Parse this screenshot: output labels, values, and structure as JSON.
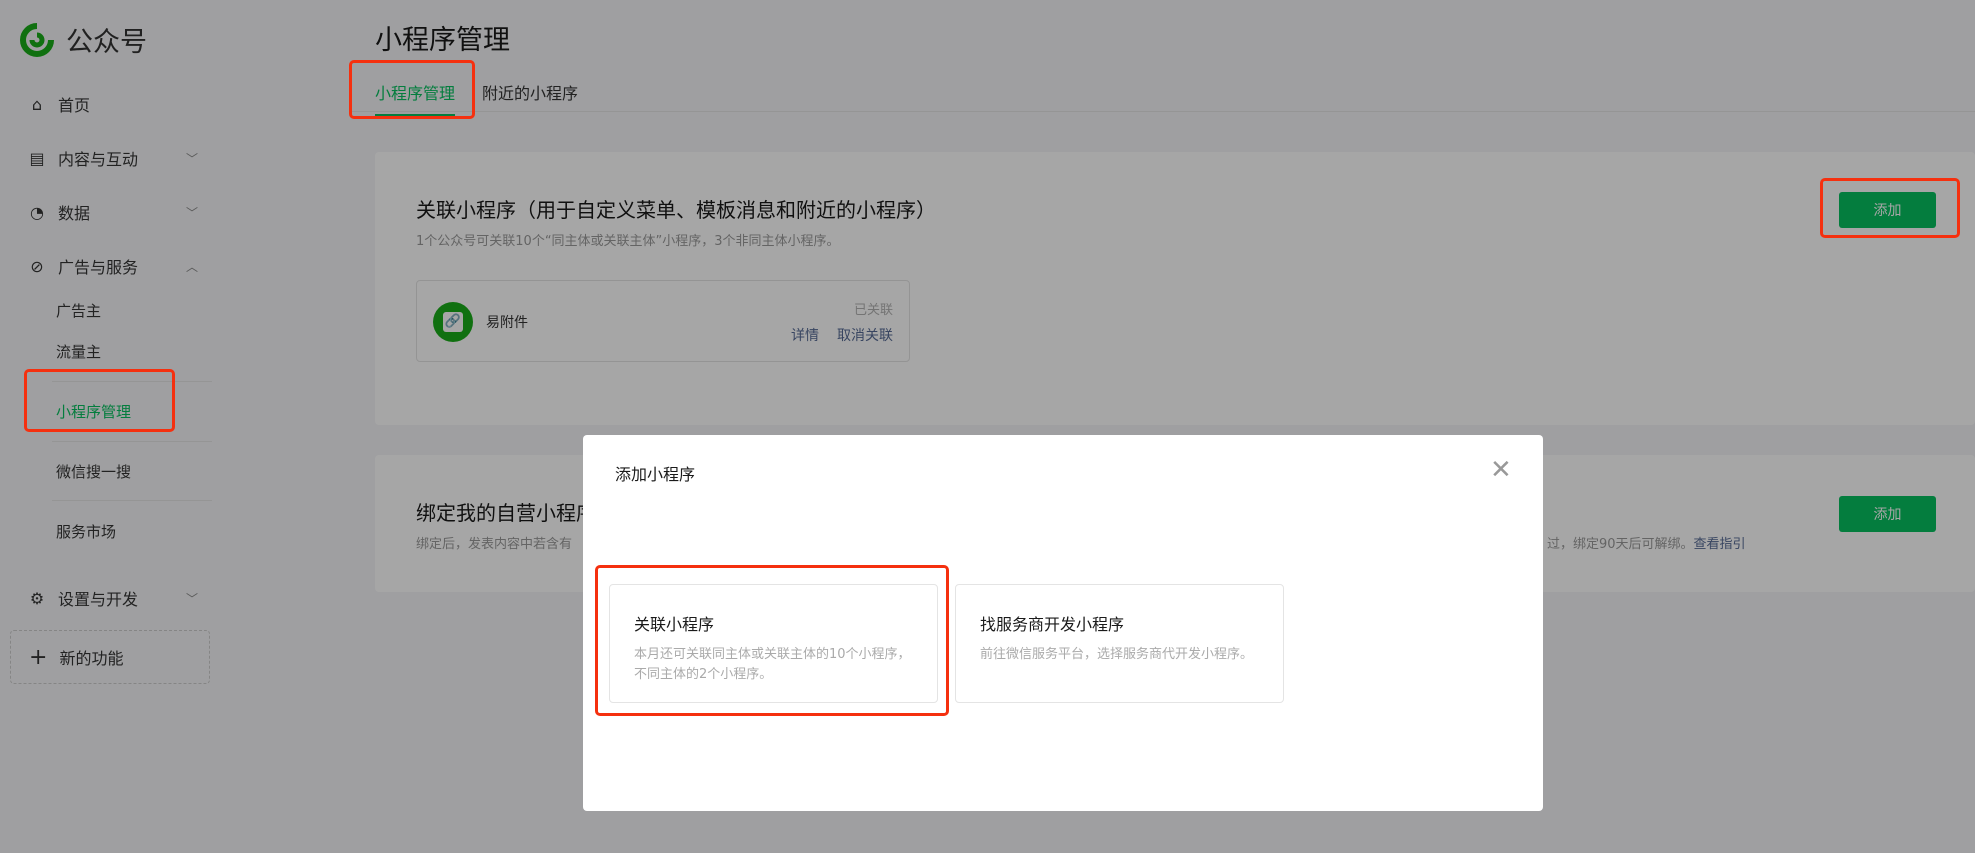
{
  "app": {
    "name": "公众号",
    "brand_color": "#07c160"
  },
  "sidebar": {
    "items": [
      {
        "label": "首页",
        "icon": "home-icon"
      },
      {
        "label": "内容与互动",
        "icon": "document-icon"
      },
      {
        "label": "数据",
        "icon": "pie-chart-icon"
      },
      {
        "label": "广告与服务",
        "icon": "compass-icon"
      },
      {
        "label": "设置与开发",
        "icon": "gear-icon"
      }
    ],
    "sub_items": [
      "广告主",
      "流量主",
      "小程序管理",
      "微信搜一搜",
      "服务市场"
    ],
    "new_feature": "新的功能"
  },
  "page": {
    "title": "小程序管理",
    "tabs": [
      "小程序管理",
      "附近的小程序"
    ]
  },
  "linked": {
    "title": "关联小程序（用于自定义菜单、模板消息和附近的小程序）",
    "desc": "1个公众号可关联10个“同主体或关联主体”小程序，3个非同主体小程序。",
    "add": "添加",
    "item": {
      "name": "易附件",
      "status": "已关联",
      "detail": "详情",
      "unlink": "取消关联"
    }
  },
  "bind": {
    "title": "绑定我的自营小程序",
    "desc_start": "绑定后，发表内容中若含有",
    "desc_end": "过，绑定90天后可解绑。",
    "guide": "查看指引",
    "add": "添加"
  },
  "modal": {
    "title": "添加小程序",
    "options": [
      {
        "title": "关联小程序",
        "desc": "本月还可关联同主体或关联主体的10个小程序，不同主体的2个小程序。"
      },
      {
        "title": "找服务商开发小程序",
        "desc": "前往微信服务平台，选择服务商代开发小程序。"
      }
    ]
  }
}
